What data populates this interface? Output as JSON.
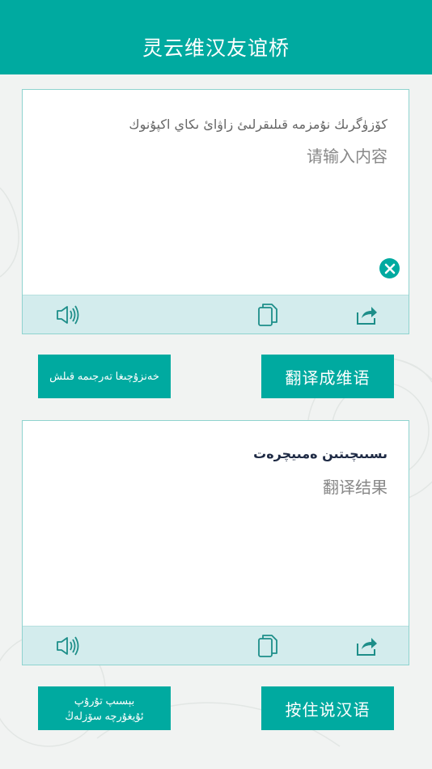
{
  "header": {
    "title": "灵云维汉友谊桥"
  },
  "input_card": {
    "uyghur_placeholder": "كۆزۈگرىك نۇمزمە قىلىقرلىئ زاۋائ ىكاي اكپۇنوك",
    "chinese_placeholder": "请输入内容"
  },
  "output_card": {
    "uyghur_label": "ىسىىچىتىن ەمىيچرەت",
    "chinese_label": "翻译结果"
  },
  "buttons": {
    "translate_to_chinese": "خەنزۇچىغا تەرجىمە قىلش",
    "translate_to_uyghur": "翻译成维语",
    "voice_uyghur_line1": "بېسىپ تۇرۇپ",
    "voice_uyghur_line2": "ئۇيغۇرچە سۆزلەڭ",
    "voice_chinese": "按住说汉语"
  },
  "icons": {
    "speaker": "speaker-icon",
    "copy": "copy-icon",
    "share": "share-icon",
    "clear": "clear-icon"
  },
  "colors": {
    "accent": "#00aaa0",
    "toolbar": "#d3eced",
    "border": "#8fd3cf"
  }
}
